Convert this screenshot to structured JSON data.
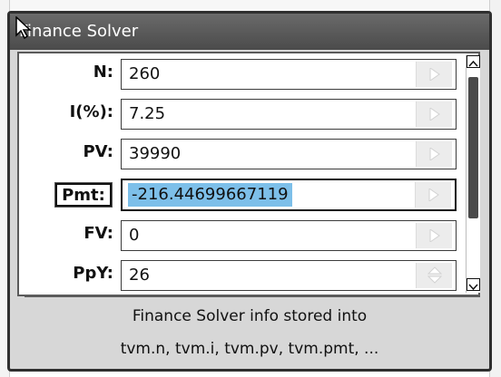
{
  "dialog": {
    "title": "Finance Solver"
  },
  "fields": [
    {
      "key": "n",
      "label": "N:",
      "value": "260"
    },
    {
      "key": "i",
      "label": "I(%):",
      "value": "7.25"
    },
    {
      "key": "pv",
      "label": "PV:",
      "value": "39990"
    },
    {
      "key": "pmt",
      "label": "Pmt:",
      "value": "-216.44699667119"
    },
    {
      "key": "fv",
      "label": "FV:",
      "value": "0"
    },
    {
      "key": "ppy",
      "label": "PpY:",
      "value": "26"
    }
  ],
  "info": {
    "line1": "Finance Solver info stored into",
    "line2": "tvm.n, tvm.i, tvm.pv, tvm.pmt, ..."
  },
  "icons": {
    "cursor": "mouse-pointer-icon",
    "solve": "right-arrow-icon",
    "spinner": "up-down-spinner-icon",
    "scroll_up": "scroll-up-arrow-icon",
    "scroll_down": "scroll-down-arrow-icon"
  },
  "colors": {
    "titlebar": "#555555",
    "selection": "#7dbfe9"
  }
}
